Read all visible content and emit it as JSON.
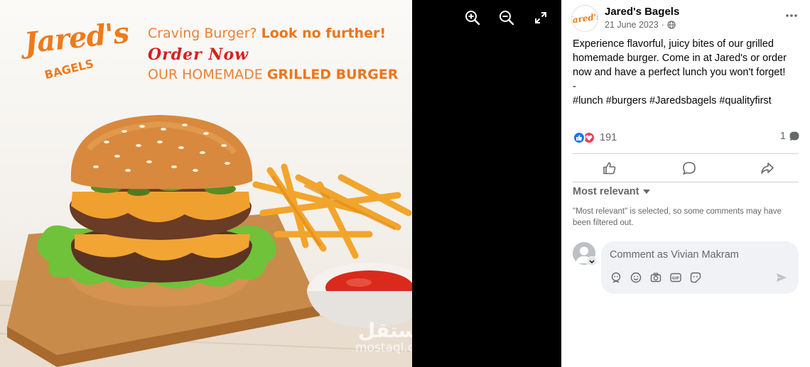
{
  "image": {
    "logo_text": "Jared's",
    "logo_subtext": "BAGELS",
    "headline_part1": "Craving Burger? ",
    "headline_part1_bold": "Look no further!",
    "headline_line2": "Order Now",
    "headline_part3": "OUR HOMEMADE ",
    "headline_part3_bold": "GRILLED BURGER",
    "watermark_arabic": "مستقل",
    "watermark_url": "mostaql.com"
  },
  "media_controls": {
    "zoom_in_icon": "zoom-in-icon",
    "zoom_out_icon": "zoom-out-icon",
    "fullscreen_icon": "fullscreen-icon"
  },
  "post": {
    "page_name": "Jared's Bagels",
    "avatar_text": "Jared's",
    "date": "21 June 2023",
    "separator": "·",
    "text_lines": [
      "Experience flavorful, juicy bites of our grilled homemade burger. Come in at Jared's or order now and have a perfect lunch you won't forget!",
      "-",
      "#lunch #burgers #Jaredsbagels #qualityfirst"
    ],
    "reaction_count": "191",
    "comment_count": "1"
  },
  "comments": {
    "sort_label": "Most relevant",
    "sort_note": "\"Most relevant\" is selected, so some comments may have been filtered out.",
    "input_placeholder": "Comment as Vivian Makram"
  },
  "colors": {
    "brand_orange": "#ef7a1a",
    "order_red": "#d81f1f",
    "like_blue": "#1877f2",
    "love_red": "#f33e58"
  }
}
